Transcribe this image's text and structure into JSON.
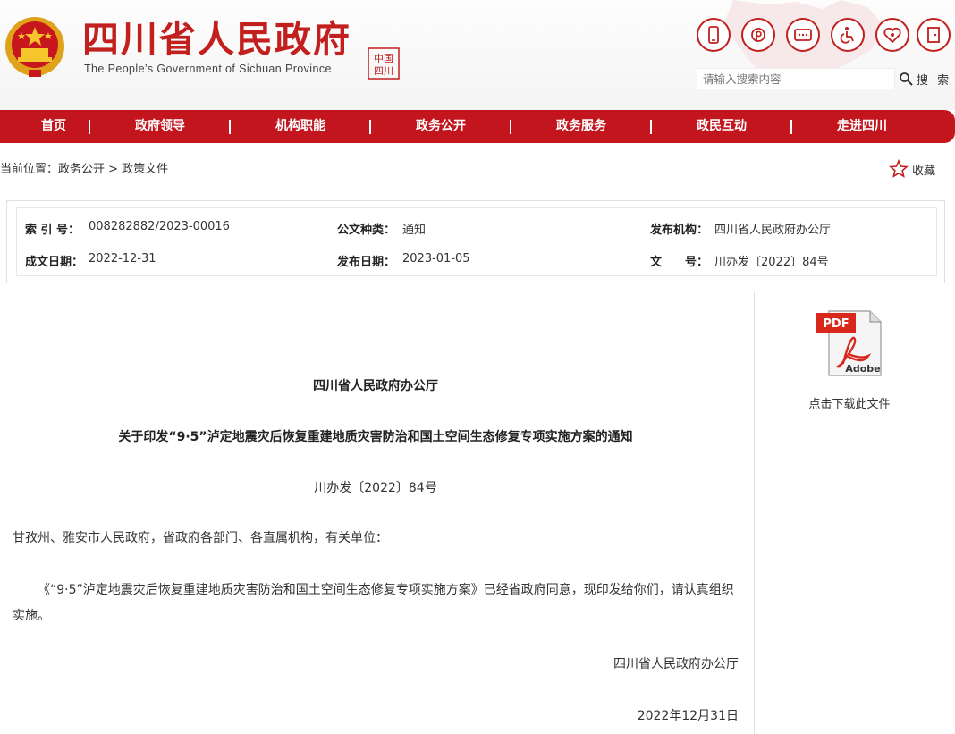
{
  "header": {
    "title": "四川省人民政府",
    "subtitle": "The People’s Government of Sichuan Province",
    "seal_text": "四川中国"
  },
  "top_icons": [
    {
      "name": "mobile-icon"
    },
    {
      "name": "weibo-icon"
    },
    {
      "name": "message-icon"
    },
    {
      "name": "accessibility-icon"
    },
    {
      "name": "care-icon"
    },
    {
      "name": "exit-icon"
    }
  ],
  "search": {
    "placeholder": "请输入搜索内容",
    "button_label": "搜 索"
  },
  "nav": {
    "items": [
      "首页",
      "政府领导",
      "机构职能",
      "政务公开",
      "政务服务",
      "政民互动",
      "走进四川"
    ]
  },
  "breadcrumb": {
    "text": "当前位置：政务公开 > 政策文件"
  },
  "collect_label": "收藏",
  "info": {
    "index_label": "索 引 号：",
    "index_value": "008282882/2023-00016",
    "type_label": "公文种类：",
    "type_value": "通知",
    "publisher_label": "发布机构：",
    "publisher_value": "四川省人民政府办公厅",
    "created_label": "成文日期：",
    "created_value": "2022-12-31",
    "published_label": "发布日期：",
    "published_value": "2023-01-05",
    "doc_label": "文　　号：",
    "doc_value": "川办发〔2022〕84号"
  },
  "sidebar": {
    "pdf_badge": "PDF",
    "pdf_brand": "Adobe",
    "download_label": "点击下载此文件"
  },
  "document": {
    "org": "四川省人民政府办公厅",
    "title": "关于印发“9·5”泸定地震灾后恢复重建地质灾害防治和国土空间生态修复专项实施方案的通知",
    "number": "川办发〔2022〕84号",
    "recipients": "甘孜州、雅安市人民政府，省政府各部门、各直属机构，有关单位：",
    "body": "《“9·5”泸定地震灾后恢复重建地质灾害防治和国土空间生态修复专项实施方案》已经省政府同意，现印发给你们，请认真组织实施。",
    "signature": "四川省人民政府办公厅",
    "date": "2022年12月31日"
  },
  "colors": {
    "brand_red": "#c2151e",
    "title_red": "#c21f1f"
  }
}
